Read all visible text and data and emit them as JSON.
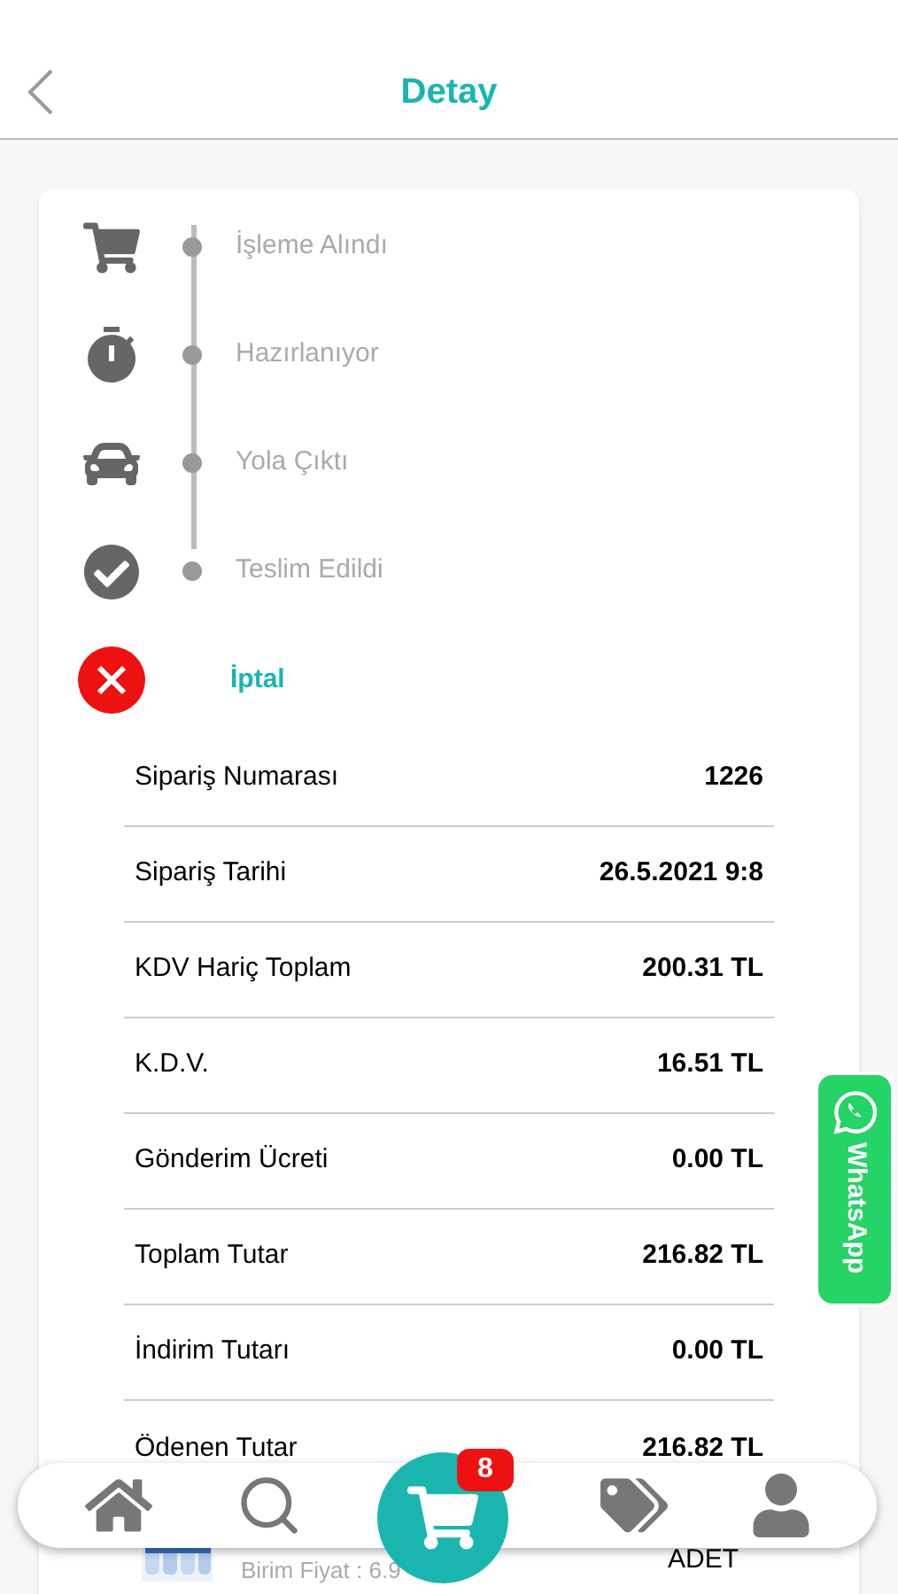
{
  "header": {
    "title": "Detay"
  },
  "steps": [
    {
      "kind": "cart",
      "label": "İşleme Alındı"
    },
    {
      "kind": "timer",
      "label": "Hazırlanıyor"
    },
    {
      "kind": "car",
      "label": "Yola Çıktı"
    },
    {
      "kind": "check",
      "label": "Teslim Edildi"
    }
  ],
  "cancel": {
    "label": "İptal"
  },
  "details": [
    {
      "label": "Sipariş Numarası",
      "value": "1226"
    },
    {
      "label": "Sipariş Tarihi",
      "value": "26.5.2021 9:8"
    },
    {
      "label": "KDV Hariç Toplam",
      "value": "200.31 TL"
    },
    {
      "label": "K.D.V.",
      "value": "16.51 TL"
    },
    {
      "label": "Gönderim Ücreti",
      "value": "0.00 TL"
    },
    {
      "label": "Toplam Tutar",
      "value": "216.82 TL"
    },
    {
      "label": "İndirim Tutarı",
      "value": "0.00 TL"
    },
    {
      "label": "Ödenen Tutar",
      "value": "216.82 TL"
    }
  ],
  "product": {
    "kind": "picture",
    "unit_price": "Birim Fiyat : 6.9",
    "unit": "ADET"
  },
  "whatsapp": {
    "label": "WhatsApp"
  },
  "nav": {
    "cart_badge": "8"
  }
}
